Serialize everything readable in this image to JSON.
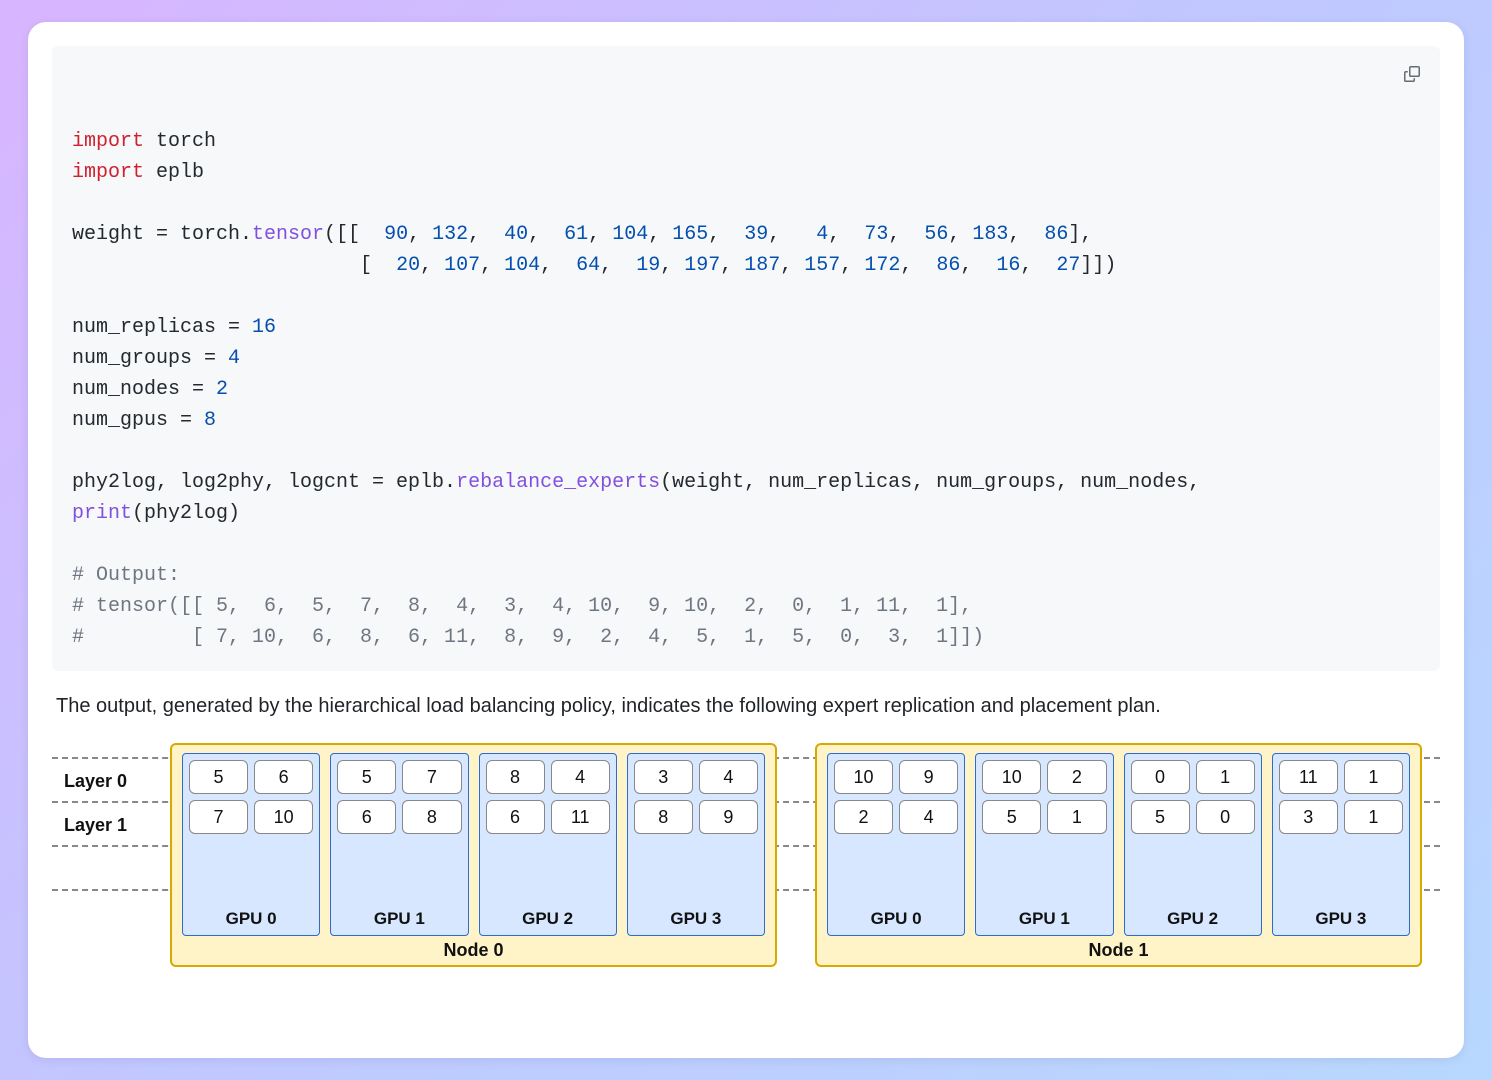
{
  "code": {
    "import_kw": "import",
    "mod1": "torch",
    "mod2": "eplb",
    "assign_weight_lhs": "weight = torch.",
    "tensor_fn": "tensor",
    "weight_row0_open": "([[ ",
    "weight_row0": [
      90,
      132,
      40,
      61,
      104,
      165,
      39,
      4,
      73,
      56,
      183,
      86
    ],
    "weight_row0_close": "],",
    "weight_row1_indent": "                        [ ",
    "weight_row1": [
      20,
      107,
      104,
      64,
      19,
      197,
      187,
      157,
      172,
      86,
      16,
      27
    ],
    "weight_row1_close": "]])",
    "num_replicas_lhs": "num_replicas = ",
    "num_replicas_val": 16,
    "num_groups_lhs": "num_groups = ",
    "num_groups_val": 4,
    "num_nodes_lhs": "num_nodes = ",
    "num_nodes_val": 2,
    "num_gpus_lhs": "num_gpus = ",
    "num_gpus_val": 8,
    "call_lhs": "phy2log, log2phy, logcnt = eplb.",
    "call_fn": "rebalance_experts",
    "call_args": "(weight, num_replicas, num_groups, num_nodes, ",
    "print_fn": "print",
    "print_args": "(phy2log)",
    "out_hdr": "# Output:",
    "out_l1": "# tensor([[ 5,  6,  5,  7,  8,  4,  3,  4, 10,  9, 10,  2,  0,  1, 11,  1],",
    "out_l2": "#         [ 7, 10,  6,  8,  6, 11,  8,  9,  2,  4,  5,  1,  5,  0,  3,  1]])"
  },
  "description": "The output, generated by the hierarchical load balancing policy, indicates the following expert replication and placement plan.",
  "diagram": {
    "layer_labels": [
      "Layer 0",
      "Layer 1"
    ],
    "nodes": [
      {
        "name": "Node 0",
        "gpus": [
          {
            "name": "GPU 0",
            "layers": [
              [
                5,
                6
              ],
              [
                7,
                10
              ]
            ]
          },
          {
            "name": "GPU 1",
            "layers": [
              [
                5,
                7
              ],
              [
                6,
                8
              ]
            ]
          },
          {
            "name": "GPU 2",
            "layers": [
              [
                8,
                4
              ],
              [
                6,
                11
              ]
            ]
          },
          {
            "name": "GPU 3",
            "layers": [
              [
                3,
                4
              ],
              [
                8,
                9
              ]
            ]
          }
        ]
      },
      {
        "name": "Node 1",
        "gpus": [
          {
            "name": "GPU 0",
            "layers": [
              [
                10,
                9
              ],
              [
                2,
                4
              ]
            ]
          },
          {
            "name": "GPU 1",
            "layers": [
              [
                10,
                2
              ],
              [
                5,
                1
              ]
            ]
          },
          {
            "name": "GPU 2",
            "layers": [
              [
                0,
                1
              ],
              [
                5,
                0
              ]
            ]
          },
          {
            "name": "GPU 3",
            "layers": [
              [
                11,
                1
              ],
              [
                3,
                1
              ]
            ]
          }
        ]
      }
    ]
  }
}
